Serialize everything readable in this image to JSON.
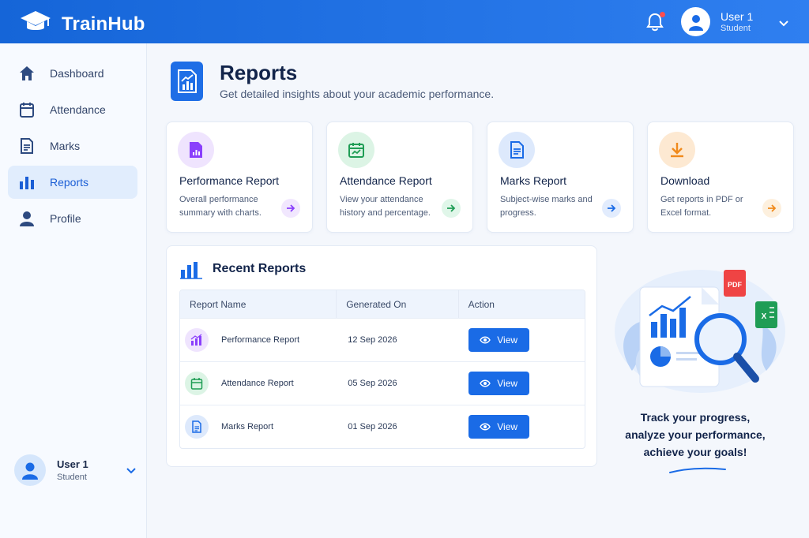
{
  "app": {
    "title": "TrainHub"
  },
  "header": {
    "user_name": "User 1",
    "user_role": "Student"
  },
  "sidebar": {
    "items": [
      {
        "label": "Dashboard",
        "icon": "home-icon",
        "active": false
      },
      {
        "label": "Attendance",
        "icon": "calendar-icon",
        "active": false
      },
      {
        "label": "Marks",
        "icon": "document-icon",
        "active": false
      },
      {
        "label": "Reports",
        "icon": "bar-chart-icon",
        "active": true
      },
      {
        "label": "Profile",
        "icon": "person-icon",
        "active": false
      }
    ],
    "user": {
      "name": "User 1",
      "role": "Student"
    }
  },
  "page": {
    "title": "Reports",
    "subtitle": "Get detailed insights about your academic performance."
  },
  "cards": [
    {
      "title": "Performance Report",
      "desc": "Overall performance summary with charts.",
      "icon": "performance-report-icon",
      "color": "#8a3ffc"
    },
    {
      "title": "Attendance Report",
      "desc": "View your attendance history and percentage.",
      "icon": "calendar-icon",
      "color": "#1f9d55"
    },
    {
      "title": "Marks Report",
      "desc": "Subject-wise marks and progress.",
      "icon": "document-icon",
      "color": "#1a6be6"
    },
    {
      "title": "Download",
      "desc": "Get reports in PDF or Excel format.",
      "icon": "download-icon",
      "color": "#f08a1c"
    }
  ],
  "recent": {
    "title": "Recent Reports",
    "columns": [
      "Report Name",
      "Generated On",
      "Action"
    ],
    "rows": [
      {
        "name": "Performance Report",
        "date": "12 Sep 2026",
        "action": "View"
      },
      {
        "name": "Attendance Report",
        "date": "05 Sep 2026",
        "action": "View"
      },
      {
        "name": "Marks Report",
        "date": "01 Sep 2026",
        "action": "View"
      }
    ]
  },
  "illustration": {
    "file_badges": [
      "PDF",
      "X"
    ],
    "tagline": [
      "Track your progress,",
      "analyze your performance,",
      "achieve your goals!"
    ]
  },
  "colors": {
    "primary": "#1a6be6",
    "header": "#1565d8"
  }
}
